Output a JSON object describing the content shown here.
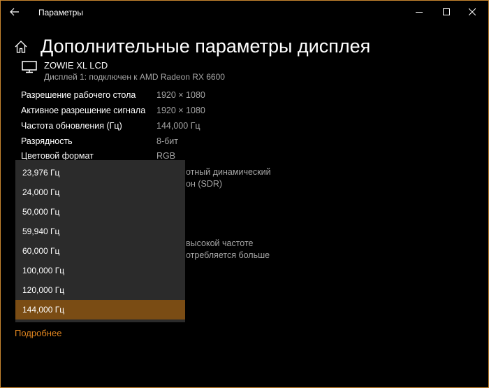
{
  "window": {
    "title": "Параметры",
    "accent_color": "#c8862f"
  },
  "header": {
    "title": "Дополнительные параметры дисплея"
  },
  "monitor": {
    "name": "ZOWIE XL LCD",
    "subtitle": "Дисплей 1: подключен к AMD Radeon RX 6600"
  },
  "info": [
    {
      "label": "Разрешение рабочего стола",
      "value": "1920 × 1080"
    },
    {
      "label": "Активное разрешение сигнала",
      "value": "1920 × 1080"
    },
    {
      "label": "Частота обновления (Гц)",
      "value": "144,000 Гц"
    },
    {
      "label": "Разрядность",
      "value": "8-бит"
    },
    {
      "label": "Цветовой формат",
      "value": "RGB"
    }
  ],
  "partial_text": {
    "line1": "отный динамический",
    "line2": "он (SDR)",
    "line3": "высокой частоте",
    "line4": "отребляется больше"
  },
  "dropdown": {
    "options": [
      "23,976 Гц",
      "24,000 Гц",
      "50,000 Гц",
      "59,940 Гц",
      "60,000 Гц",
      "100,000 Гц",
      "120,000 Гц",
      "144,000 Гц"
    ],
    "selected": "144,000 Гц",
    "selected_color": "#7a4c14"
  },
  "more_link": "Подробнее",
  "icons": {
    "back": "back-arrow-icon",
    "minimize": "minimize-icon",
    "maximize": "maximize-icon",
    "close": "close-icon",
    "home": "home-icon",
    "monitor": "monitor-icon"
  }
}
